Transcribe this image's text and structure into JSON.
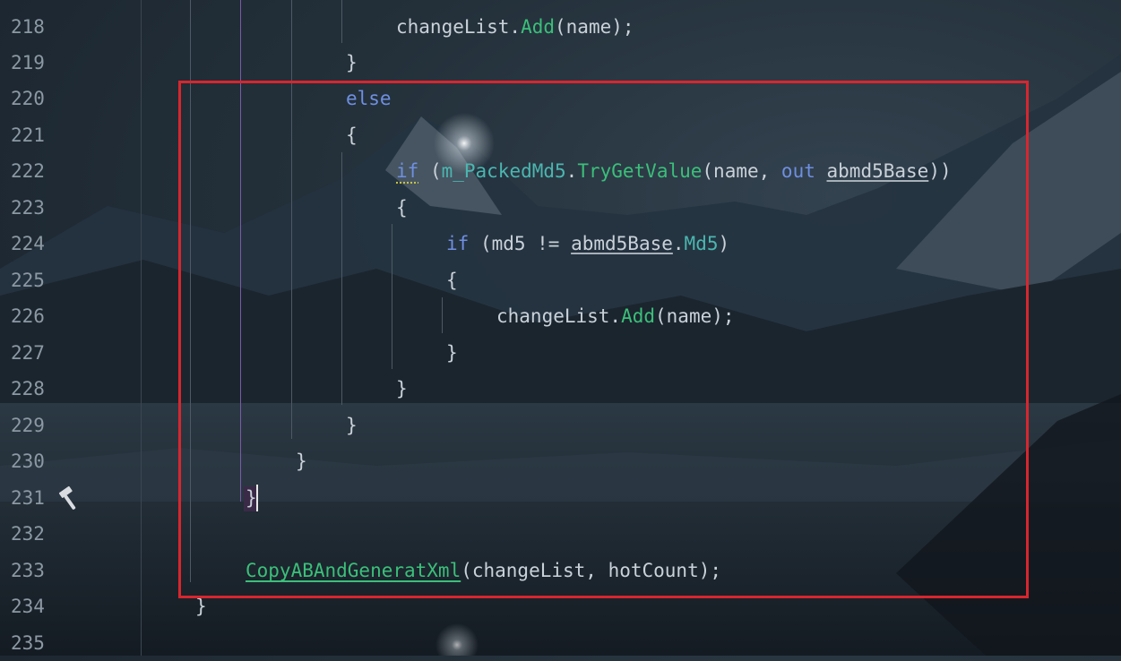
{
  "editor": {
    "line_numbers": [
      "218",
      "219",
      "220",
      "221",
      "222",
      "223",
      "224",
      "225",
      "226",
      "227",
      "228",
      "229",
      "230",
      "231",
      "232",
      "233",
      "234",
      "235"
    ],
    "lines": {
      "l218": {
        "a": "changeList.",
        "b": "Add",
        "c": "(name);"
      },
      "l219": {
        "a": "}"
      },
      "l220": {
        "a": "else"
      },
      "l221": {
        "a": "{"
      },
      "l222": {
        "kw1": "if",
        "p1": " (",
        "v1": "m_PackedMd5",
        "p2": ".",
        "f1": "TryGetValue",
        "p3": "(name, ",
        "kw2": "out",
        "p4": " ",
        "v2": "abmd5Base",
        "p5": "))"
      },
      "l223": {
        "a": "{"
      },
      "l224": {
        "kw1": "if",
        "p1": " (md5 != ",
        "v1": "abmd5Base",
        "p2": ".",
        "pr": "Md5",
        "p3": ")"
      },
      "l225": {
        "a": "{"
      },
      "l226": {
        "a": "changeList.",
        "b": "Add",
        "c": "(name);"
      },
      "l227": {
        "a": "}"
      },
      "l228": {
        "a": "}"
      },
      "l229": {
        "a": "}"
      },
      "l230": {
        "a": "}"
      },
      "l231": {
        "a": "}"
      },
      "l233": {
        "f": "CopyABAndGeneratXml",
        "a": "(changeList, hotCount);"
      },
      "l234": {
        "a": "}"
      }
    },
    "gutter_icon": "hammer-icon"
  },
  "colors": {
    "highlight_box": "#d8262e",
    "keyword": "#6f8fe0",
    "method": "#3bbf7a",
    "property": "#4bb6b0"
  }
}
